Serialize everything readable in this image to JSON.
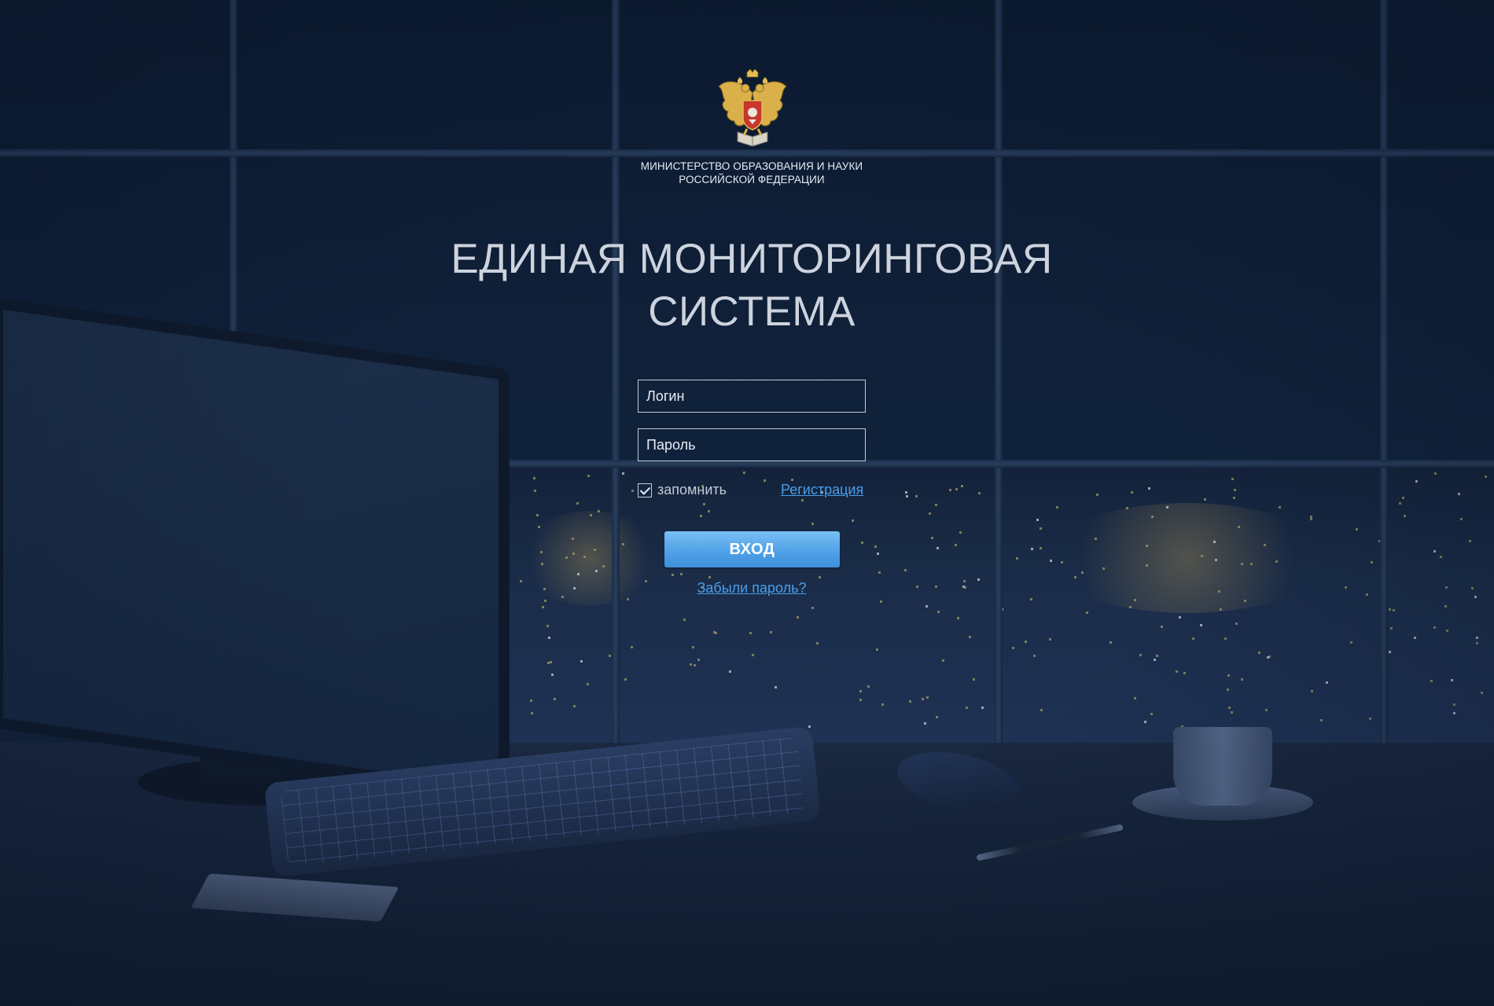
{
  "header": {
    "ministry_line1": "МИНИСТЕРСТВО ОБРАЗОВАНИЯ И НАУКИ",
    "ministry_line2": "РОССИЙСКОЙ ФЕДЕРАЦИИ",
    "emblem_icon": "russian-coat-of-arms-icon"
  },
  "title": {
    "line1": "ЕДИНАЯ МОНИТОРИНГОВАЯ",
    "line2": "СИСТЕМА"
  },
  "login_form": {
    "login_placeholder": "Логин",
    "password_placeholder": "Пароль",
    "remember_label": "запомнить",
    "remember_checked": true,
    "register_link": "Регистрация",
    "submit_label": "ВХОД",
    "forgot_link": "Забыли пароль?"
  },
  "colors": {
    "link": "#4a9eea",
    "button": "#5aa8ea",
    "background": "#0d1d33"
  }
}
